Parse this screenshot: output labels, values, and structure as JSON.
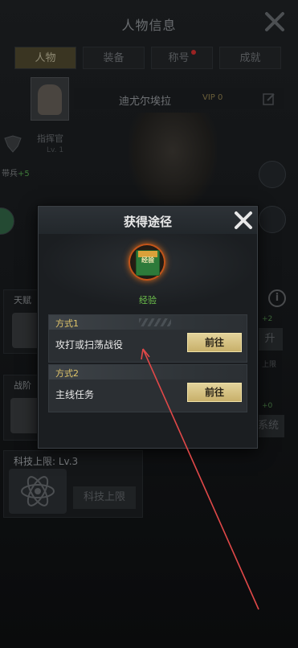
{
  "header": {
    "title": "人物信息"
  },
  "tabs": [
    {
      "label": "人物",
      "active": true
    },
    {
      "label": "装备",
      "active": false
    },
    {
      "label": "称号",
      "active": false,
      "has_dot": true
    },
    {
      "label": "成就",
      "active": false
    }
  ],
  "profile": {
    "name": "迪尤尔埃拉",
    "vip": "VIP 0",
    "commander_label": "指挥官",
    "commander_level": "Lv. 1",
    "bring_label": "带兵",
    "bring_value": "+5"
  },
  "background_panels": {
    "talent_title": "天赋",
    "talent_value": "+2",
    "talent_limit": "上限",
    "rank_title": "战阶",
    "rank_value": "+0",
    "rank_button": "系统",
    "tech_title": "科技上限: Lv.3",
    "tech_button": "科技上限"
  },
  "modal": {
    "title": "获得途径",
    "item_name": "经验",
    "item_icon_label": "经验",
    "methods": [
      {
        "tag": "方式1",
        "description": "攻打或扫荡战役",
        "button": "前往"
      },
      {
        "tag": "方式2",
        "description": "主线任务",
        "button": "前往"
      }
    ]
  },
  "colors": {
    "accent_gold": "#e3d39b",
    "item_green": "#6ec24c",
    "method_tag": "#e0c56a",
    "annotation_arrow": "#e04848"
  }
}
